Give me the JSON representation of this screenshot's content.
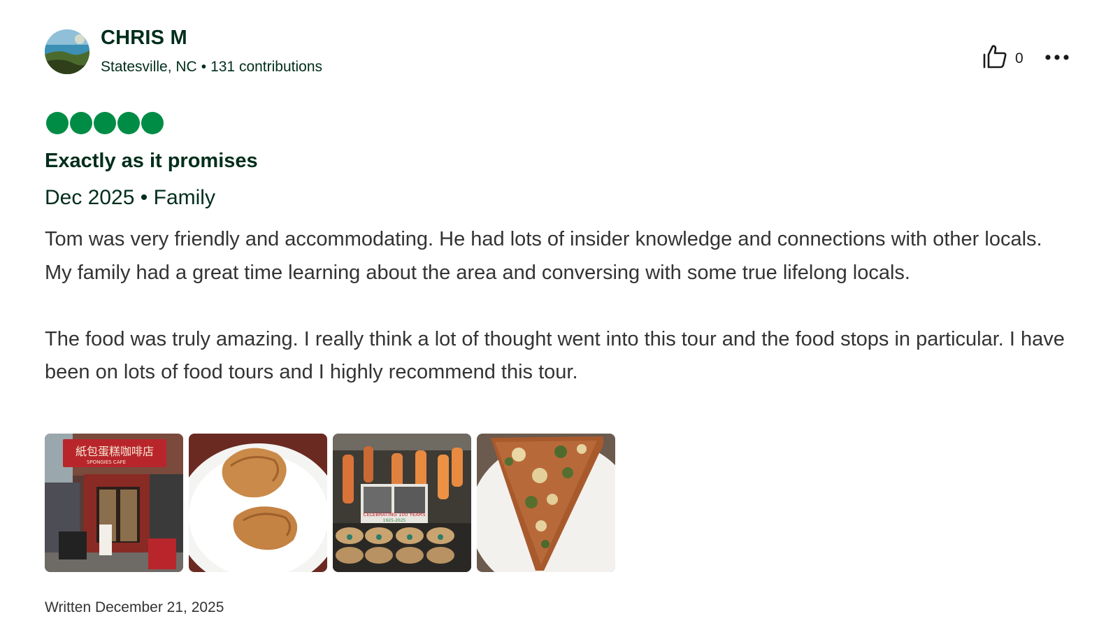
{
  "user": {
    "name": "CHRIS M",
    "location": "Statesville, NC",
    "separator": "•",
    "contributions": "131 contributions",
    "avatar_icon": "beach-avatar"
  },
  "actions": {
    "helpful_icon": "thumbs-up-icon",
    "helpful_count": "0",
    "more_icon": "more-horizontal-icon"
  },
  "review": {
    "rating": 5,
    "rating_max": 5,
    "rating_color": "#008c45",
    "title": "Exactly as it promises",
    "date": "Dec 2025",
    "trip_separator": "•",
    "trip_type": "Family",
    "paragraphs": [
      "Tom was very friendly and accommodating. He had lots of insider knowledge and connections with other locals. My family had a great time learning about the area and conversing with some true lifelong locals.",
      "The food was truly amazing. I really think a lot of thought went into this tour and the food stops in particular. I have been on lots of food tours and I highly recommend this tour."
    ],
    "written_date": "Written December 21, 2025"
  },
  "photos": [
    {
      "name": "storefront-photo",
      "sign_text": "紙包蛋糕咖啡店",
      "sub_text": "SPONGIES CAFE"
    },
    {
      "name": "dumplings-photo"
    },
    {
      "name": "shop-window-photo",
      "sign_text": "CELEBRATING 100 YEARS",
      "sub_text": "1925-2025"
    },
    {
      "name": "pizza-slice-photo"
    }
  ],
  "colors": {
    "heading": "#002d1b",
    "body": "#333333",
    "bubble": "#008c45"
  }
}
